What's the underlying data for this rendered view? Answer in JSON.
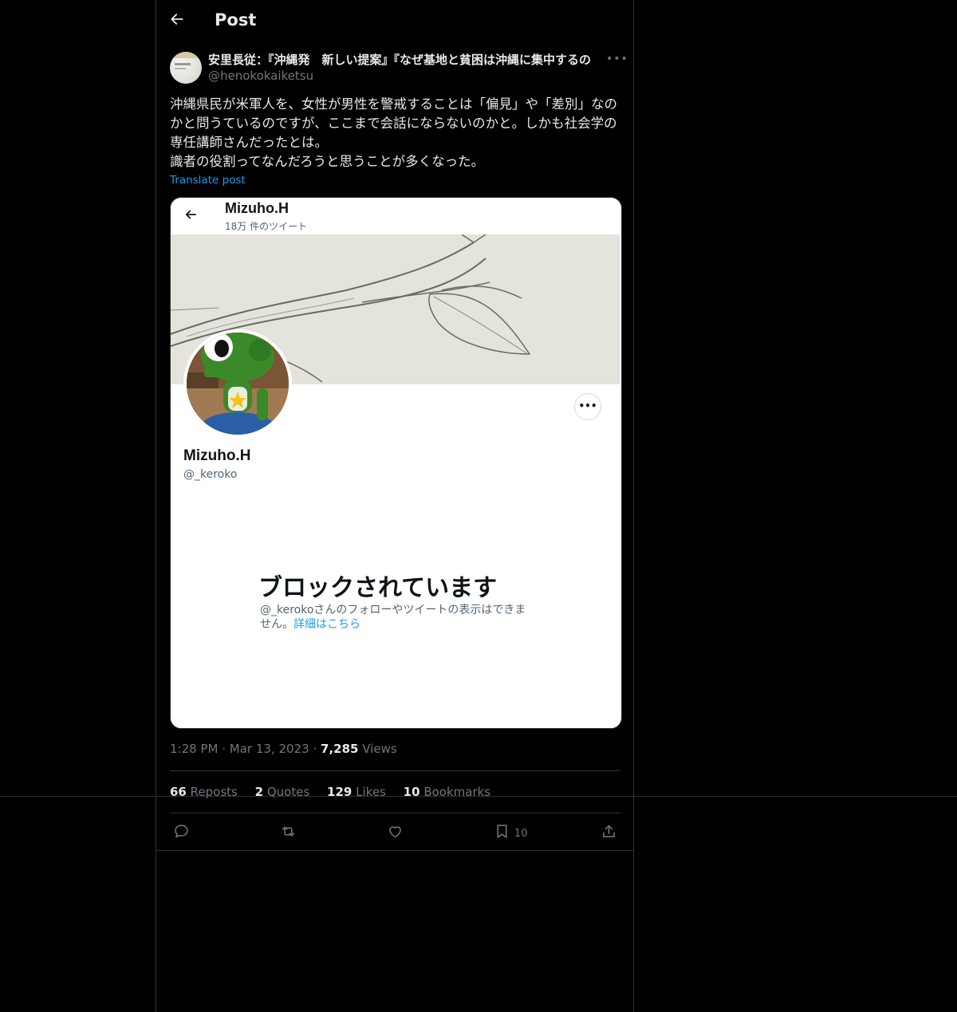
{
  "header": {
    "title": "Post"
  },
  "post": {
    "author_name": "安里長従：『沖縄発　新しい提案』『なぜ基地と貧困は沖縄に集中するの",
    "author_handle": "@henokokaiketsu",
    "more_label": "•••",
    "text_lines": [
      "沖縄県民が米軍人を、女性が男性を警戒することは「偏見」や「差別」なのかと問うているのですが、ここまで会話にならないのかと。しかも社会学の専任講師さんだったとは。",
      "識者の役割ってなんだろうと思うことが多くなった。"
    ],
    "translate_label": "Translate post",
    "time": "1:28 PM",
    "date": "Mar 13, 2023",
    "views_count": "7,285",
    "views_label": "Views",
    "dot": "·"
  },
  "embedded_screenshot": {
    "name": "Mizuho.H",
    "tweet_count": "18万 件のツイート",
    "display_name": "Mizuho.H",
    "handle": "@_keroko",
    "more_label": "•••",
    "blocked_title": "ブロックされています",
    "blocked_desc": "@_kerokoさんのフォローやツイートの表示はできません。",
    "link_text": "詳細はこちら"
  },
  "stats": [
    {
      "count": "66",
      "label": "Reposts"
    },
    {
      "count": "2",
      "label": "Quotes"
    },
    {
      "count": "129",
      "label": "Likes"
    },
    {
      "count": "10",
      "label": "Bookmarks"
    }
  ],
  "actions": {
    "bookmark_count": "10",
    "icons": [
      "reply-icon",
      "repost-icon",
      "like-icon",
      "bookmark-icon",
      "share-icon"
    ]
  },
  "colors": {
    "background": "#000000",
    "text": "#e7e9ea",
    "muted": "#71767b",
    "accent": "#1d9bf0",
    "border": "#2f3336"
  }
}
